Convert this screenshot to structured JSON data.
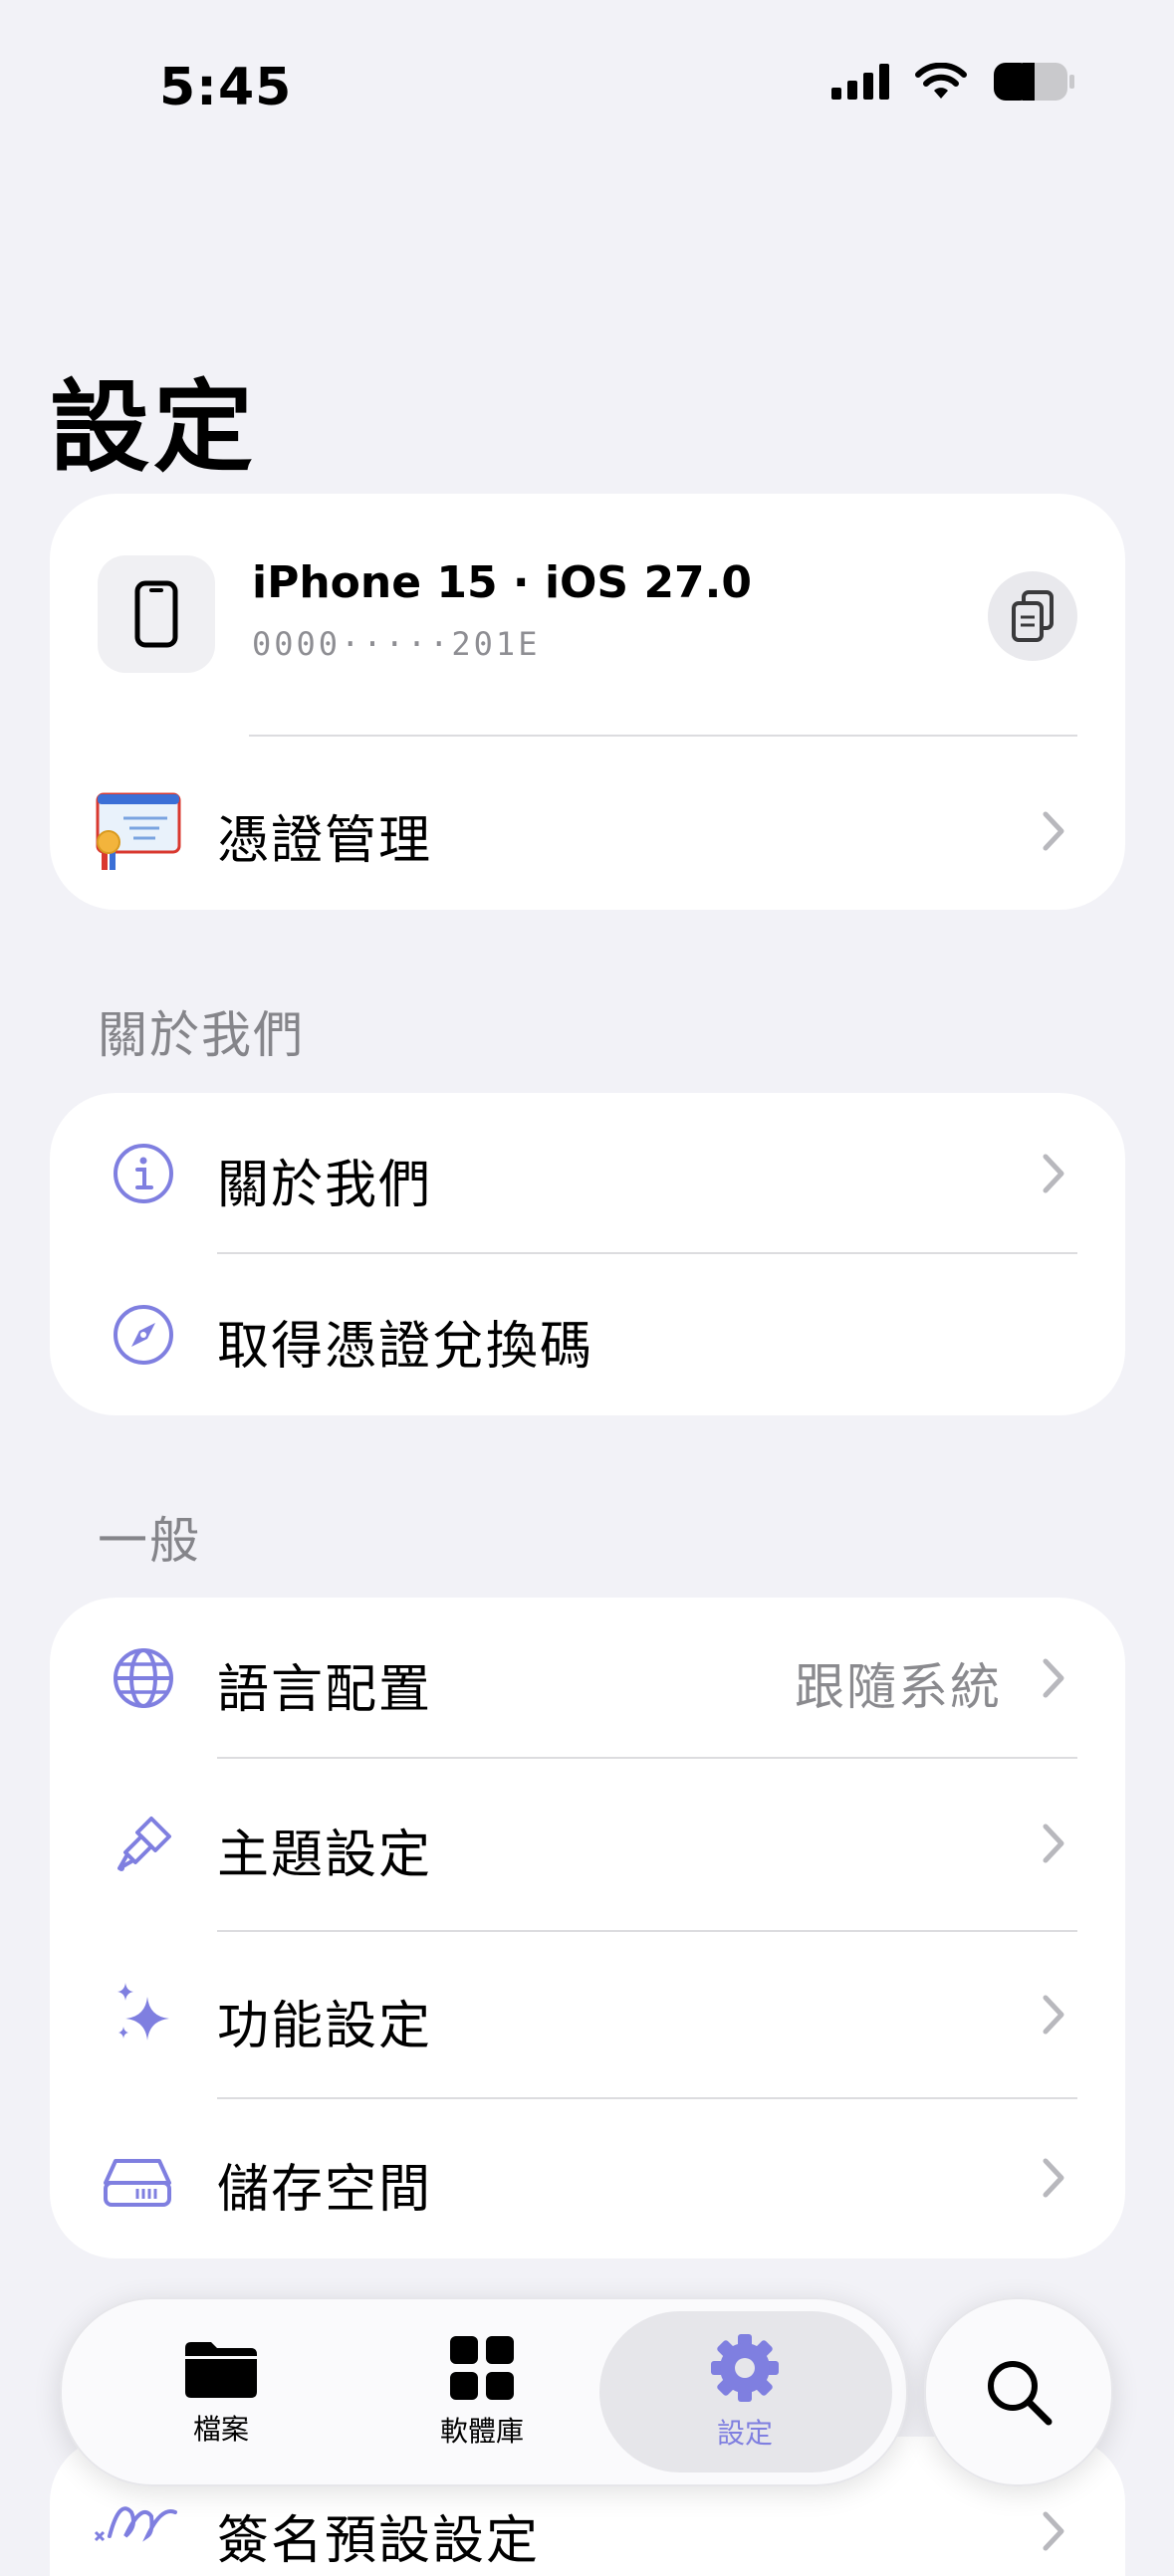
{
  "status_bar": {
    "time": "5:45"
  },
  "page_title": "設定",
  "device_card": {
    "device_name": "iPhone 15 · iOS 27.0",
    "device_id": "0000·····201E",
    "certificate_label": "憑證管理"
  },
  "about_section": {
    "header": "關於我們",
    "items": [
      {
        "label": "關於我們",
        "icon": "info-icon"
      },
      {
        "label": "取得憑證兌換碼",
        "icon": "compass-icon"
      }
    ]
  },
  "general_section": {
    "header": "一般",
    "items": [
      {
        "label": "語言配置",
        "value": "跟隨系統",
        "icon": "globe-icon"
      },
      {
        "label": "主題設定",
        "icon": "paintbrush-icon"
      },
      {
        "label": "功能設定",
        "icon": "sparkles-icon"
      },
      {
        "label": "儲存空間",
        "icon": "drive-icon"
      },
      {
        "label": "簽名預設設定",
        "icon": "signature-icon"
      }
    ]
  },
  "tab_bar": {
    "tabs": [
      {
        "label": "檔案",
        "icon": "folder-icon"
      },
      {
        "label": "軟體庫",
        "icon": "grid-icon"
      },
      {
        "label": "設定",
        "icon": "gear-icon",
        "active": true
      }
    ],
    "search_icon": "search-icon"
  },
  "colors": {
    "accent": "#7f7fe0",
    "background": "#f2f2f7",
    "chevron": "#b8b8bd"
  }
}
